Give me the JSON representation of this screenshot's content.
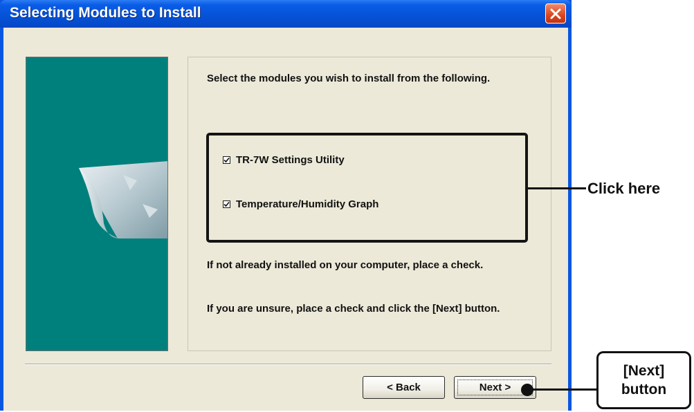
{
  "window": {
    "title": "Selecting Modules to Install",
    "close_icon": "close-icon"
  },
  "content": {
    "intro": "Select the modules you wish to install from the following.",
    "modules": [
      {
        "label": "TR-7W Settings Utility",
        "checked": true
      },
      {
        "label": "Temperature/Humidity Graph",
        "checked": true
      }
    ],
    "note1": "If not already installed on your computer, place a check.",
    "note2": "If you are unsure, place a check and click the [Next] button."
  },
  "buttons": {
    "back": "< Back",
    "next": "Next >"
  },
  "annotations": {
    "click_here": "Click here",
    "next_callout_line1": "[Next]",
    "next_callout_line2": "button"
  },
  "colors": {
    "titlebar": "#0a56e0",
    "dialog_bg": "#ece9d8",
    "art_panel": "#00807c",
    "close_button": "#d9461f"
  }
}
